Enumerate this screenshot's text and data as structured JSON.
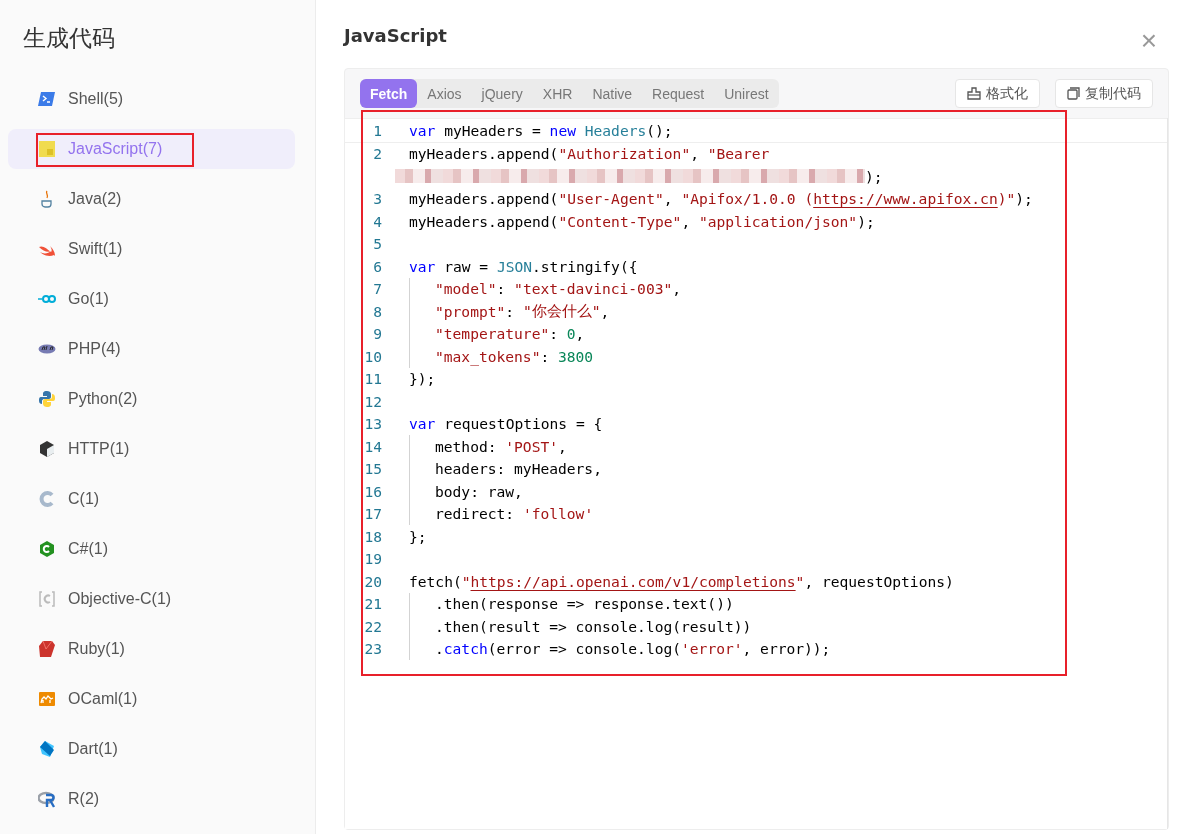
{
  "sidebar": {
    "title": "生成代码",
    "items": [
      {
        "label": "Shell(5)",
        "selected": false
      },
      {
        "label": "JavaScript(7)",
        "selected": true
      },
      {
        "label": "Java(2)",
        "selected": false
      },
      {
        "label": "Swift(1)",
        "selected": false
      },
      {
        "label": "Go(1)",
        "selected": false
      },
      {
        "label": "PHP(4)",
        "selected": false
      },
      {
        "label": "Python(2)",
        "selected": false
      },
      {
        "label": "HTTP(1)",
        "selected": false
      },
      {
        "label": "C(1)",
        "selected": false
      },
      {
        "label": "C#(1)",
        "selected": false
      },
      {
        "label": "Objective-C(1)",
        "selected": false
      },
      {
        "label": "Ruby(1)",
        "selected": false
      },
      {
        "label": "OCaml(1)",
        "selected": false
      },
      {
        "label": "Dart(1)",
        "selected": false
      },
      {
        "label": "R(2)",
        "selected": false
      }
    ]
  },
  "dialog": {
    "title": "JavaScript",
    "close": "×",
    "tabs": [
      {
        "label": "Fetch",
        "selected": true
      },
      {
        "label": "Axios",
        "selected": false
      },
      {
        "label": "jQuery",
        "selected": false
      },
      {
        "label": "XHR",
        "selected": false
      },
      {
        "label": "Native",
        "selected": false
      },
      {
        "label": "Request",
        "selected": false
      },
      {
        "label": "Unirest",
        "selected": false
      }
    ],
    "actions": [
      {
        "label": "格式化",
        "kind": "format"
      },
      {
        "label": "复制代码",
        "kind": "copy"
      }
    ],
    "code": [
      {
        "n": "1",
        "tokens": [
          {
            "kind": "kw",
            "t": "var"
          },
          {
            "kind": "p",
            "t": " myHeaders = "
          },
          {
            "kind": "kw",
            "t": "new"
          },
          {
            "kind": "type",
            "t": " Headers"
          },
          {
            "kind": "p",
            "t": "();"
          }
        ]
      },
      {
        "n": "2",
        "tokens": [
          {
            "kind": "p",
            "t": "myHeaders.append("
          },
          {
            "kind": "str",
            "t": "\"Authorization\""
          },
          {
            "kind": "p",
            "t": ", "
          },
          {
            "kind": "str",
            "t": "\"Bearer"
          }
        ],
        "wrap": [
          {
            "kind": "redacted"
          },
          {
            "kind": "p",
            "t": ");"
          }
        ]
      },
      {
        "n": "3",
        "tokens": [
          {
            "kind": "p",
            "t": "myHeaders.append("
          },
          {
            "kind": "str",
            "t": "\"User-Agent\""
          },
          {
            "kind": "p",
            "t": ", "
          },
          {
            "kind": "str",
            "t": "\"Apifox/1.0.0 ("
          },
          {
            "kind": "link",
            "t": "https://www.apifox.cn"
          },
          {
            "kind": "str",
            "t": ")\""
          },
          {
            "kind": "p",
            "t": ");"
          }
        ]
      },
      {
        "n": "4",
        "tokens": [
          {
            "kind": "p",
            "t": "myHeaders.append("
          },
          {
            "kind": "str",
            "t": "\"Content-Type\""
          },
          {
            "kind": "p",
            "t": ", "
          },
          {
            "kind": "str",
            "t": "\"application/json\""
          },
          {
            "kind": "p",
            "t": ");"
          }
        ]
      },
      {
        "n": "5"
      },
      {
        "n": "6",
        "tokens": [
          {
            "kind": "kw",
            "t": "var"
          },
          {
            "kind": "p",
            "t": " raw = "
          },
          {
            "kind": "type",
            "t": "JSON"
          },
          {
            "kind": "p",
            "t": ".stringify({"
          }
        ]
      },
      {
        "n": "7",
        "indent": true,
        "tokens": [
          {
            "kind": "str",
            "t": "\"model\""
          },
          {
            "kind": "p",
            "t": ": "
          },
          {
            "kind": "str",
            "t": "\"text-davinci-003\""
          },
          {
            "kind": "p",
            "t": ","
          }
        ]
      },
      {
        "n": "8",
        "indent": true,
        "tokens": [
          {
            "kind": "str",
            "t": "\"prompt\""
          },
          {
            "kind": "p",
            "t": ": "
          },
          {
            "kind": "str",
            "t": "\"你会什么\""
          },
          {
            "kind": "p",
            "t": ","
          }
        ]
      },
      {
        "n": "9",
        "indent": true,
        "tokens": [
          {
            "kind": "str",
            "t": "\"temperature\""
          },
          {
            "kind": "p",
            "t": ": "
          },
          {
            "kind": "num",
            "t": "0"
          },
          {
            "kind": "p",
            "t": ","
          }
        ]
      },
      {
        "n": "10",
        "indent": true,
        "tokens": [
          {
            "kind": "str",
            "t": "\"max_tokens\""
          },
          {
            "kind": "p",
            "t": ": "
          },
          {
            "kind": "num",
            "t": "3800"
          }
        ]
      },
      {
        "n": "11",
        "tokens": [
          {
            "kind": "p",
            "t": "});"
          }
        ]
      },
      {
        "n": "12"
      },
      {
        "n": "13",
        "tokens": [
          {
            "kind": "kw",
            "t": "var"
          },
          {
            "kind": "p",
            "t": " requestOptions = {"
          }
        ]
      },
      {
        "n": "14",
        "indent": true,
        "tokens": [
          {
            "kind": "p",
            "t": "method: "
          },
          {
            "kind": "str",
            "t": "'POST'"
          },
          {
            "kind": "p",
            "t": ","
          }
        ]
      },
      {
        "n": "15",
        "indent": true,
        "tokens": [
          {
            "kind": "p",
            "t": "headers: myHeaders,"
          }
        ]
      },
      {
        "n": "16",
        "indent": true,
        "tokens": [
          {
            "kind": "p",
            "t": "body: raw,"
          }
        ]
      },
      {
        "n": "17",
        "indent": true,
        "tokens": [
          {
            "kind": "p",
            "t": "redirect: "
          },
          {
            "kind": "str",
            "t": "'follow'"
          }
        ]
      },
      {
        "n": "18",
        "tokens": [
          {
            "kind": "p",
            "t": "};"
          }
        ]
      },
      {
        "n": "19"
      },
      {
        "n": "20",
        "tokens": [
          {
            "kind": "p",
            "t": "fetch("
          },
          {
            "kind": "str",
            "t": "\""
          },
          {
            "kind": "link",
            "t": "https://api.openai.com/v1/completions"
          },
          {
            "kind": "str",
            "t": "\""
          },
          {
            "kind": "p",
            "t": ", requestOptions)"
          }
        ]
      },
      {
        "n": "21",
        "indent": true,
        "tokens": [
          {
            "kind": "p",
            "t": ".then(response => response.text())"
          }
        ]
      },
      {
        "n": "22",
        "indent": true,
        "tokens": [
          {
            "kind": "p",
            "t": ".then(result => console.log(result))"
          }
        ]
      },
      {
        "n": "23",
        "indent": true,
        "tokens": [
          {
            "kind": "p",
            "t": "."
          },
          {
            "kind": "kw",
            "t": "catch"
          },
          {
            "kind": "p",
            "t": "(error => console.log("
          },
          {
            "kind": "str",
            "t": "'error'"
          },
          {
            "kind": "p",
            "t": ", error));"
          }
        ]
      }
    ]
  }
}
